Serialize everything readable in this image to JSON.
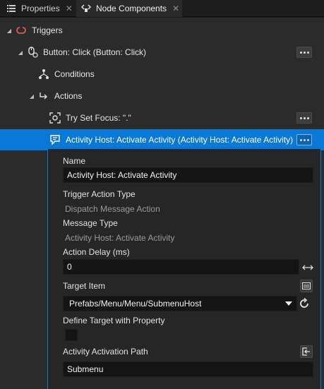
{
  "tabs": [
    {
      "label": "Properties",
      "icon": "list-icon",
      "active": false
    },
    {
      "label": "Node Components",
      "icon": "node-components-icon",
      "active": true
    }
  ],
  "tree": {
    "triggers": {
      "label": "Triggers",
      "icon": "trigger-icon"
    },
    "button_click": {
      "label": "Button: Click (Button: Click)",
      "icon": "click-icon"
    },
    "conditions": {
      "label": "Conditions",
      "icon": "conditions-icon"
    },
    "actions": {
      "label": "Actions",
      "icon": "actions-icon"
    },
    "try_set_focus": {
      "label": "Try Set Focus: \".\"",
      "icon": "focus-icon"
    },
    "activity_host": {
      "label": "Activity Host: Activate Activity (Activity Host: Activate Activity)",
      "icon": "message-action-icon"
    }
  },
  "properties": {
    "name_label": "Name",
    "name_value": "Activity Host: Activate Activity",
    "trigger_action_type_label": "Trigger Action Type",
    "trigger_action_type_value": "Dispatch Message Action",
    "message_type_label": "Message Type",
    "message_type_value": "Activity Host: Activate Activity",
    "action_delay_label": "Action Delay (ms)",
    "action_delay_value": "0",
    "target_item_label": "Target Item",
    "target_item_value": "Prefabs/Menu/Menu/SubmenuHost",
    "define_target_label": "Define Target with Property",
    "define_target_checked": false,
    "activation_path_label": "Activity Activation Path",
    "activation_path_value": "Submenu"
  },
  "colors": {
    "selection": "#0a78d7",
    "trigger_icon": "#e0585b"
  }
}
